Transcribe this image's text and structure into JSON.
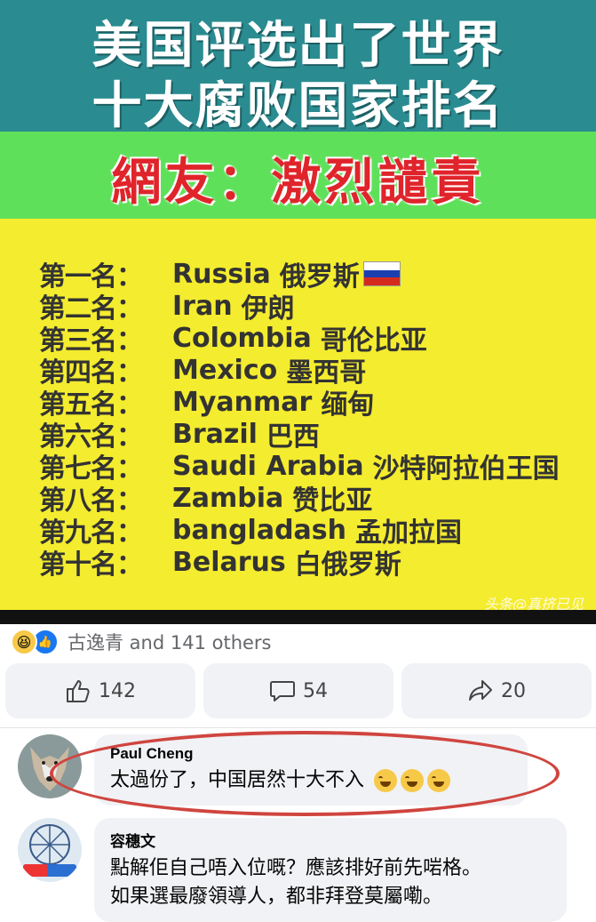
{
  "image": {
    "title_line1": "美国评选出了世界",
    "title_line2": "十大腐败国家排名",
    "subtitle": "網友：激烈譴責",
    "rankings": [
      {
        "label": "第一名：",
        "en": "Russia",
        "zh": "俄罗斯"
      },
      {
        "label": "第二名：",
        "en": "Iran",
        "zh": "伊朗"
      },
      {
        "label": "第三名：",
        "en": "Colombia",
        "zh": "哥伦比亚"
      },
      {
        "label": "第四名：",
        "en": "Mexico",
        "zh": "墨西哥"
      },
      {
        "label": "第五名：",
        "en": "Myanmar",
        "zh": "缅甸"
      },
      {
        "label": "第六名：",
        "en": "Brazil",
        "zh": "巴西"
      },
      {
        "label": "第七名：",
        "en": "Saudi Arabia",
        "zh": "沙特阿拉伯王国"
      },
      {
        "label": "第八名：",
        "en": "Zambia",
        "zh": "赞比亚"
      },
      {
        "label": "第九名：",
        "en": "bangladash",
        "zh": "孟加拉国"
      },
      {
        "label": "第十名：",
        "en": "Belarus",
        "zh": "白俄罗斯"
      }
    ],
    "watermark": "头条@真挤已见",
    "colors": {
      "title_bg": "#2a8c91",
      "green": "#5fe05a",
      "yellow": "#f4ec2e",
      "red_text": "#e0242b"
    }
  },
  "reactions": {
    "icons": [
      "haha-icon",
      "like-icon"
    ],
    "text": "古逸青 and 141 others"
  },
  "actions": {
    "like_count": "142",
    "comment_count": "54",
    "share_count": "20"
  },
  "comments": [
    {
      "author": "Paul Cheng",
      "text": "太過份了，中国居然十大不入",
      "emojis": 3,
      "highlighted": true
    },
    {
      "author": "容穗文",
      "line1": "點解佢自己唔入位嘅？應該排好前先啱格。",
      "line2": "如果選最廢領導人，都非拜登莫屬嘞。"
    }
  ]
}
